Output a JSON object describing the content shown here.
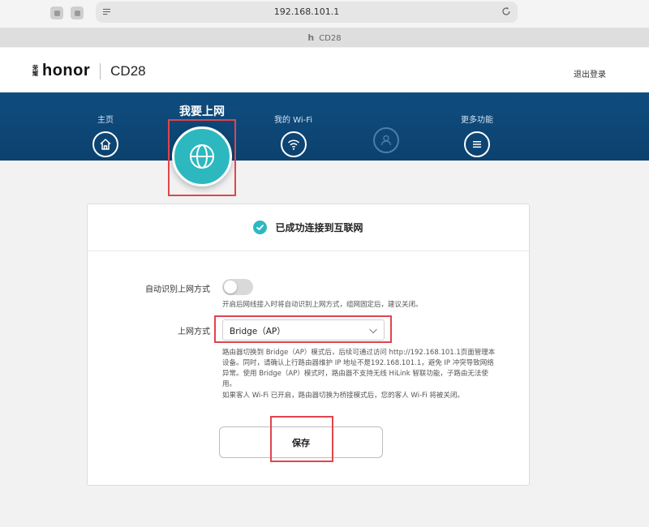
{
  "browser": {
    "url": "192.168.101.1",
    "tab_title": "CD28",
    "tab_logo": "h"
  },
  "header": {
    "brand_badge": "荣耀",
    "brand": "honor",
    "model": "CD28",
    "logout": "退出登录"
  },
  "nav": {
    "items": [
      {
        "label": "主页",
        "icon": "home-icon"
      },
      {
        "label": "我要上网",
        "icon": "globe-icon",
        "active": true
      },
      {
        "label": "我的 Wi-Fi",
        "icon": "wifi-icon"
      },
      {
        "label": "",
        "icon": "user-icon"
      },
      {
        "label": "更多功能",
        "icon": "menu-icon"
      }
    ]
  },
  "status": {
    "text": "已成功连接到互联网"
  },
  "form": {
    "auto_detect_label": "自动识别上网方式",
    "auto_detect_enabled": false,
    "auto_detect_hint": "开启后网线接入时将自动识别上网方式，组网固定后，建议关闭。",
    "mode_label": "上网方式",
    "mode_value": "Bridge（AP）",
    "mode_hint_1": "路由器切换到 Bridge（AP）模式后，后续可通过访问 http://192.168.101.1页面管理本",
    "mode_hint_2": "设备。同时，请确认上行路由器维护 IP 地址不是192.168.101.1，避免 IP 冲突导致网络",
    "mode_hint_3": "异常。使用 Bridge（AP）模式时，路由器不支持无线 HiLink 智联功能，子路由无法使",
    "mode_hint_4": "用。",
    "guest_hint": "如果客人 Wi-Fi 已开启，路由器切换为桥接模式后，您的客人 Wi-Fi 将被关闭。",
    "save_label": "保存"
  },
  "colors": {
    "nav_blue": "#0f4d7f",
    "accent_teal": "#2db8c0",
    "highlight_red": "#e0454d"
  }
}
